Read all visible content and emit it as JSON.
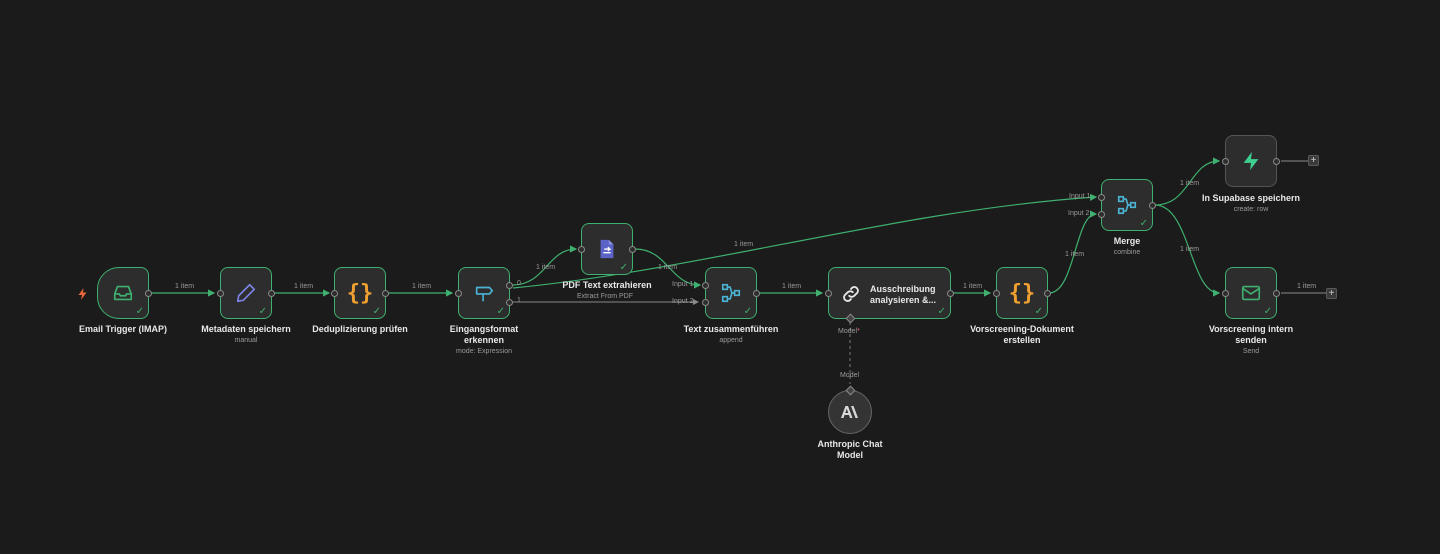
{
  "edge_label": "1 item",
  "trigger_icon": "bolt-icon",
  "nodes": {
    "email_trigger": {
      "title": "Email Trigger (IMAP)",
      "icon": "inbox-icon"
    },
    "metadaten": {
      "title": "Metadaten speichern",
      "subtitle": "manual",
      "icon": "pencil-icon"
    },
    "deduplizierung": {
      "title": "Deduplizierung prüfen",
      "icon": "code-braces-icon"
    },
    "eingangsformat": {
      "title_line1": "Eingangsformat",
      "title_line2": "erkennen",
      "subtitle": "mode: Expression",
      "icon": "signpost-icon",
      "output_0": "0",
      "output_1": "1"
    },
    "pdf_text": {
      "title": "PDF Text extrahieren",
      "icon": "pdf-document-icon"
    },
    "text_zusammen": {
      "title": "Text zusammenführen",
      "subtitle": "append",
      "icon": "merge-icon",
      "input_1": "Input 1",
      "input_2": "Input 2"
    },
    "ausschreibung": {
      "title_line1": "Ausschreibung",
      "title_line2": "analysieren &...",
      "icon": "link-icon",
      "model_port": "Model"
    },
    "anthropic": {
      "title_line1": "Anthropic Chat",
      "title_line2": "Model",
      "icon": "anthropic-icon",
      "model_port": "Model"
    },
    "vorscreening_dok": {
      "title_line1": "Vorscreening-Dokument",
      "title_line2": "erstellen",
      "icon": "code-braces-icon"
    },
    "merge": {
      "title": "Merge",
      "subtitle": "combine",
      "icon": "merge-icon",
      "input_1": "Input 1",
      "input_2": "Input 2"
    },
    "supabase": {
      "title": "In Supabase speichern",
      "subtitle": "create: row",
      "icon": "supabase-icon"
    },
    "vorscreening_send": {
      "title_line1": "Vorscreening intern",
      "title_line2": "senden",
      "subtitle": "Send",
      "icon": "envelope-icon"
    }
  },
  "extract_from_pdf_label": "Extract From PDF",
  "model_required_marker": "*",
  "colors": {
    "background": "#1b1b1b",
    "node_fill": "#2d2d2d",
    "success_green": "#3fb06f",
    "edge_gray": "#8a8a8a",
    "icon_teal": "#4bb3d4",
    "icon_orange": "#f0a030",
    "icon_purple": "#7c83e6",
    "icon_pdf": "#5b63c7",
    "icon_supabase": "#3ecf8e"
  }
}
